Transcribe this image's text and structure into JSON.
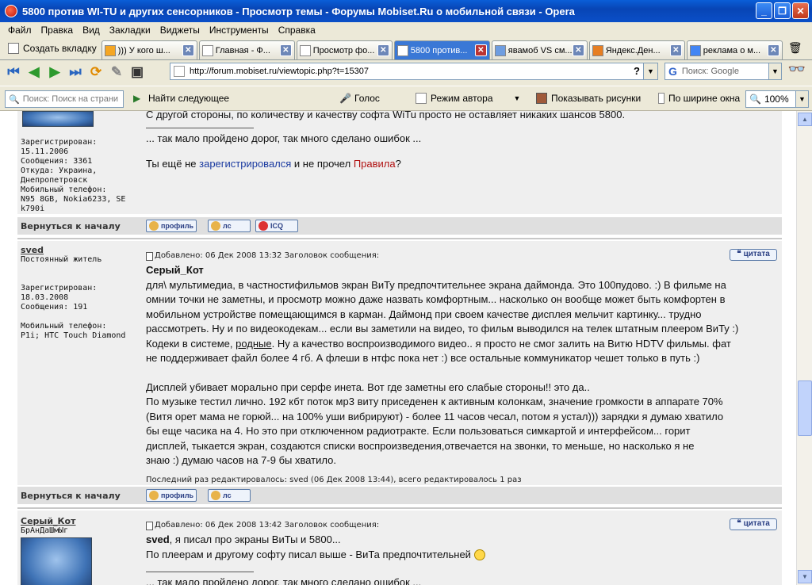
{
  "window": {
    "title": "5800 против WI-TU и других сенсорников - Просмотр темы - Форумы Mobiset.Ru о мобильной связи - Opera"
  },
  "menu": [
    "Файл",
    "Правка",
    "Вид",
    "Закладки",
    "Виджеты",
    "Инструменты",
    "Справка"
  ],
  "tabs": {
    "new_tab": "Создать вкладку",
    "items": [
      {
        "label": "))) У кого ш..."
      },
      {
        "label": "Главная - Ф..."
      },
      {
        "label": "Просмотр фо..."
      },
      {
        "label": "5800 против..."
      },
      {
        "label": "явамоб VS см..."
      },
      {
        "label": "Яндекс.Ден..."
      },
      {
        "label": "реклама о м..."
      }
    ]
  },
  "address": {
    "url": "http://forum.mobiset.ru/viewtopic.php?t=15307",
    "search_placeholder": "Поиск: Google"
  },
  "findbar": {
    "placeholder": "Поиск: Поиск на страни",
    "find_next": "Найти следующее",
    "voice": "Голос",
    "author_mode": "Режим автора",
    "show_images": "Показывать рисунки",
    "fit_width": "По ширине окна",
    "zoom": "100%"
  },
  "post1": {
    "text1": "С другой стороны, по количеству и качеству софта WiTu просто не оставляет никаких шансов 5800.",
    "sig": "... так мало пройдено дорог, так много сделано ошибок ...",
    "reg_prefix": "Ты ещё не ",
    "reg_link": "зарегистрировался",
    "reg_mid": " и не прочел ",
    "rules_link": "Правила",
    "reg_suffix": "?",
    "info": [
      "Зарегистрирован:",
      "15.11.2006",
      "Сообщения: 3361",
      "Откуда: Украина,",
      "Днепропетровск",
      "Мобильный телефон:",
      "N95 8GB, Nokia6233, SE",
      "k790i"
    ]
  },
  "back_label": "Вернуться к началу",
  "buttons": {
    "profile": "профиль",
    "pm": "лс",
    "icq": "ICQ",
    "quote": "цитата"
  },
  "post2": {
    "user": "sved",
    "rank": "Постоянный житель",
    "info": [
      "Зарегистрирован:",
      "18.03.2008",
      "Сообщения: 191",
      "",
      "Мобильный телефон:",
      "P1i; HTC Touch Diamond"
    ],
    "header": "Добавлено: 06 Дек 2008 13:32   Заголовок сообщения:",
    "author": "Серый_Кот",
    "lines": [
      "для\\ мультимедиа, в частностифильмов экран ВиТу предпочтительнее экрана даймонда. Это 100пудово. :) В фильме на",
      "омнии точки не заметны, и просмотр можно даже назвать комфортным... насколько он вообще может быть комфортен в",
      "мобильном устройстве помещающимся в карман. Даймонд при своем качестве дисплея мельчит картинку... трудно",
      "рассмотреть. Ну и по видеокодекам... если вы заметили на видео, то фильм выводился на телек штатным плеером ВиТу :)",
      "Кодеки в системе, ",
      "родные",
      ". Ну а качество воспроизводимого видео.. я просто не смог залить на Витю HDTV фильмы. фат",
      "не поддерживает файл более 4 гб. А флеши в нтфс пока нет :) все остальные коммуникатор чешет только в путь :)",
      "",
      "Дисплей убивает морально при серфе инета. Вот где заметны его слабые стороны!! это да..",
      "По музыке тестил лично. 192 кбт поток мр3 виту приседенен к активным колонкам, значение громкости в аппарате 70%",
      "(Витя орет мама не горюй... на 100% уши вибрируют) - более 11 часов чесал, потом я устал))) зарядки я думаю хватило",
      "бы еще часика на 4. Но это при отключенном радиотракте. Если пользоваться симкартой и интерфейсом... горит",
      "дисплей, тыкается экран, создаются списки воспроизведения,отвечается на звонки, то меньше, но насколько я не",
      "знаю :) думаю часов на 7-9 бы хватило."
    ],
    "edited": "Последний раз редактировалось: sved (06 Дек 2008 13:44), всего редактировалось 1 раз"
  },
  "post3": {
    "user": "Серый_Кот",
    "rank": "БрАнДаШмЫг",
    "header": "Добавлено: 06 Дек 2008 13:42   Заголовок сообщения:",
    "author": "sved",
    "line1": ", я писал про экраны ВиТы и 5800...",
    "line2": "По плеерам и другому софту писал выше - ВиТа предпочтительней ",
    "line3": "... так мало пройдено дорог, так много сделано ошибок ..."
  }
}
